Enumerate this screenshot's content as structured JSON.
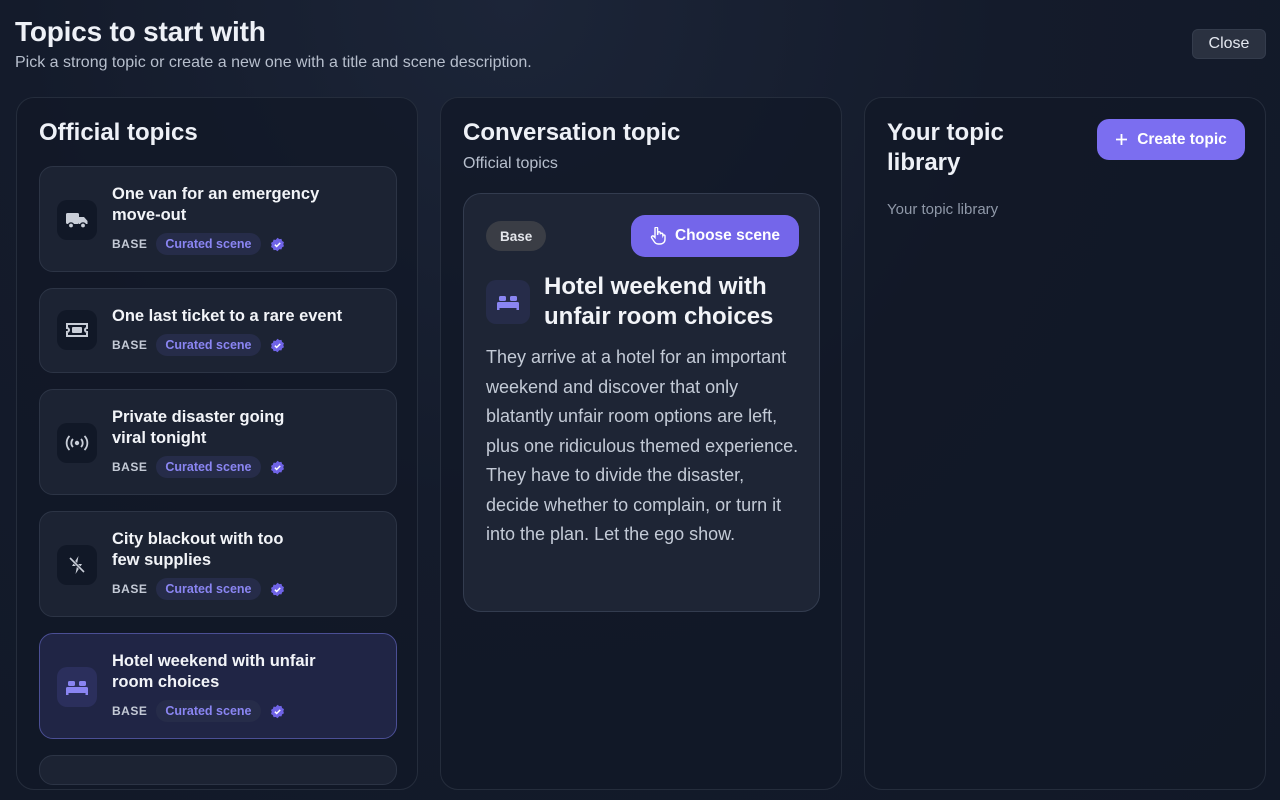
{
  "header": {
    "title": "Topics to start with",
    "subtitle": "Pick a strong topic or create a new one with a title and scene description.",
    "close_label": "Close"
  },
  "official_panel": {
    "title": "Official topics",
    "topics": [
      {
        "title": "One van for an emergency move-out",
        "line1": "One van for an emergency",
        "line2": "move-out",
        "base": "BASE",
        "chip": "Curated scene",
        "icon": "truck-icon"
      },
      {
        "title": "One last ticket to a rare event",
        "line1": "One last ticket to a rare event",
        "line2": "",
        "base": "BASE",
        "chip": "Curated scene",
        "icon": "ticket-icon"
      },
      {
        "title": "Private disaster going viral tonight",
        "line1": "Private disaster going",
        "line2": "viral tonight",
        "base": "BASE",
        "chip": "Curated scene",
        "icon": "broadcast-icon"
      },
      {
        "title": "City blackout with too few supplies",
        "line1": "City blackout with too",
        "line2": "few supplies",
        "base": "BASE",
        "chip": "Curated scene",
        "icon": "no-power-icon"
      },
      {
        "title": "Hotel weekend with unfair room choices",
        "line1": "Hotel weekend with unfair",
        "line2": "room choices",
        "base": "BASE",
        "chip": "Curated scene",
        "icon": "bed-icon",
        "selected": true
      }
    ]
  },
  "conversation_panel": {
    "title": "Conversation topic",
    "subtitle": "Official topics",
    "badge": "Base",
    "choose_label": "Choose scene",
    "topic_title": "Hotel weekend with unfair room choices",
    "description": "They arrive at a hotel for an important weekend and discover that only blatantly unfair room options are left, plus one ridiculous themed experience. They have to divide the disaster, decide whether to complain, or turn it into the plan. Let the ego show."
  },
  "library_panel": {
    "title": "Your topic library",
    "create_label": "Create topic",
    "empty_text": "Your topic library"
  },
  "colors": {
    "accent": "#7466ea",
    "chip_text": "#8a85f2",
    "background": "#141b2b"
  }
}
